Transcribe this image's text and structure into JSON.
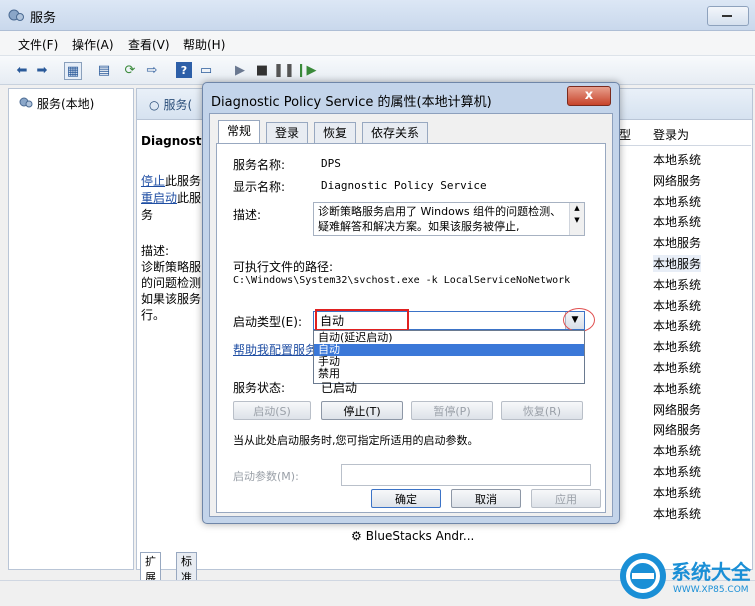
{
  "window": {
    "title": "服务"
  },
  "menu": [
    "文件(F)",
    "操作(A)",
    "查看(V)",
    "帮助(H)"
  ],
  "left_pane": {
    "item": "服务(本地)"
  },
  "right_pane": {
    "header": "服务(",
    "service_title": "Diagnosti",
    "stop_link": "停止",
    "stop_suffix": "此服务",
    "restart_link": "重启动",
    "restart_suffix": "此服务",
    "desc_label": "描述:",
    "desc_lines": [
      "诊断策略服",
      "的问题检测",
      "如果该服务",
      "行。"
    ],
    "column_type": "型",
    "column_logon": "登录为",
    "logon_values": [
      "本地系统",
      "网络服务",
      "本地系统",
      "本地系统",
      "本地服务",
      "本地服务",
      "本地系统",
      "本地系统",
      "本地系统",
      "本地系统",
      "本地系统",
      "本地系统",
      "网络服务",
      "网络服务",
      "本地系统",
      "本地系统",
      "本地系统",
      "本地系统"
    ],
    "bluestacks": "BlueStacks Andr...",
    "bottom_tabs": [
      "扩展",
      "标准"
    ]
  },
  "dialog": {
    "title": "Diagnostic Policy Service 的属性(本地计算机)",
    "close": "x",
    "tabs": [
      "常规",
      "登录",
      "恢复",
      "依存关系"
    ],
    "service_name_label": "服务名称:",
    "service_name": "DPS",
    "display_name_label": "显示名称:",
    "display_name": "Diagnostic Policy Service",
    "description_label": "描述:",
    "description": "诊断策略服务启用了 Windows 组件的问题检测、疑难解答和解决方案。如果该服务被停止,",
    "exe_path_label": "可执行文件的路径:",
    "exe_path": "C:\\Windows\\System32\\svchost.exe -k LocalServiceNoNetwork",
    "startup_type_label": "启动类型(E):",
    "startup_type": "自动",
    "startup_options": [
      "自动(延迟启动)",
      "自动",
      "手动",
      "禁用"
    ],
    "help_link": "帮助我配置服务启",
    "status_label": "服务状态:",
    "status_value": "已启动",
    "buttons": {
      "start": "启动(S)",
      "stop": "停止(T)",
      "pause": "暂停(P)",
      "resume": "恢复(R)"
    },
    "hint": "当从此处启动服务时,您可指定所适用的启动参数。",
    "param_label": "启动参数(M):",
    "ok": "确定",
    "cancel": "取消",
    "apply": "应用"
  },
  "watermark": {
    "text": "系统大全",
    "url": "WWW.XP85.COM"
  }
}
